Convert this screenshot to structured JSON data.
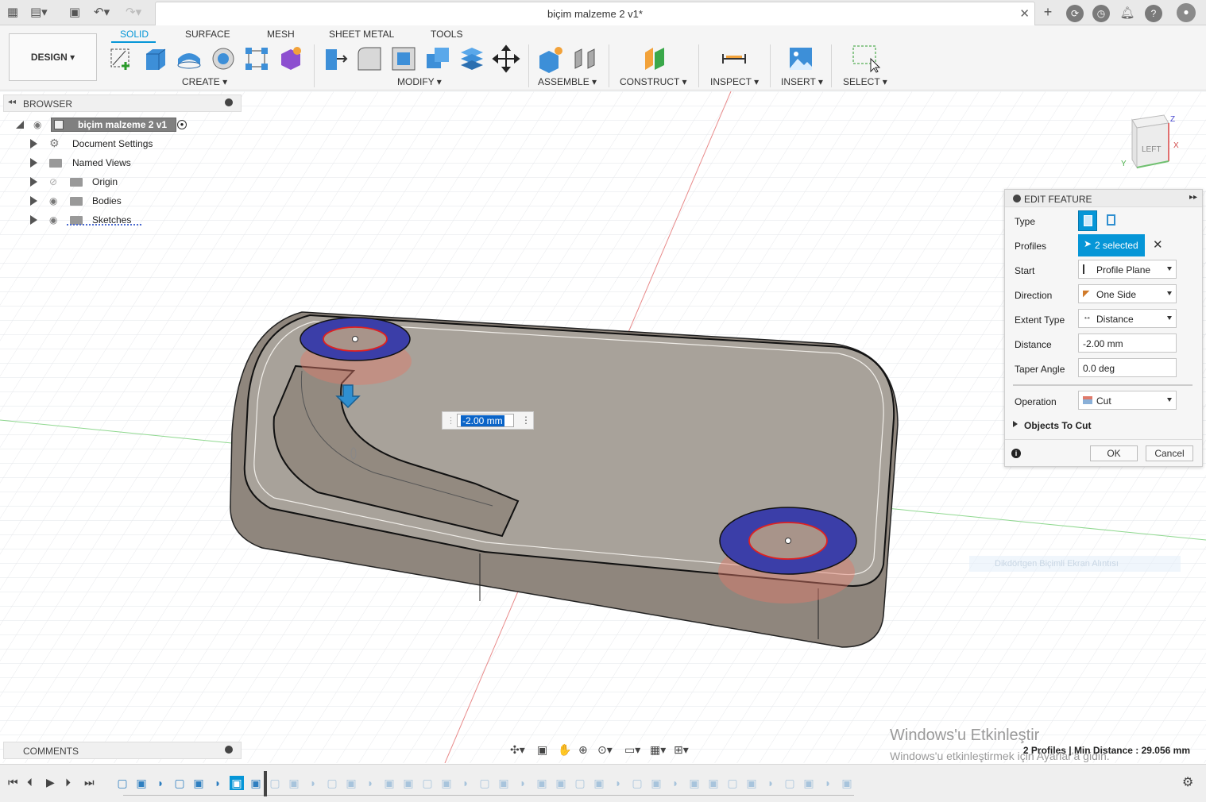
{
  "window": {
    "title": "biçim malzeme 2 v1*"
  },
  "workspace": {
    "design_label": "DESIGN",
    "tabs": [
      "SOLID",
      "SURFACE",
      "MESH",
      "SHEET METAL",
      "TOOLS"
    ],
    "groups": [
      "CREATE",
      "MODIFY",
      "ASSEMBLE",
      "CONSTRUCT",
      "INSPECT",
      "INSERT",
      "SELECT"
    ]
  },
  "browser": {
    "title": "BROWSER",
    "root": "biçim malzeme 2 v1",
    "items": [
      "Document Settings",
      "Named Views",
      "Origin",
      "Bodies",
      "Sketches"
    ]
  },
  "viewcube": {
    "face": "LEFT",
    "z": "Z",
    "x": "X",
    "y": "Y"
  },
  "dimension_input": {
    "value": "-2.00 mm"
  },
  "edit_feature": {
    "title": "EDIT FEATURE",
    "labels": {
      "type": "Type",
      "profiles": "Profiles",
      "start": "Start",
      "direction": "Direction",
      "extent_type": "Extent Type",
      "distance": "Distance",
      "taper_angle": "Taper Angle",
      "operation": "Operation"
    },
    "profiles_value": "2 selected",
    "start_value": "Profile Plane",
    "direction_value": "One Side",
    "extent_type_value": "Distance",
    "distance_value": "-2.00 mm",
    "taper_angle_value": "0.0 deg",
    "operation_value": "Cut",
    "objects_to_cut": "Objects To Cut",
    "ok": "OK",
    "cancel": "Cancel"
  },
  "comments": {
    "title": "COMMENTS"
  },
  "status": {
    "text": "2 Profiles | Min Distance : 29.056 mm"
  },
  "watermark": {
    "line1": "Windows'u Etkinleştir",
    "line2": "Windows'u etkinleştirmek için Ayarlar'a gidin."
  },
  "ghost_tooltip": "Dikdörtgen Biçimli Ekran Alıntısı",
  "colors": {
    "accent": "#0696d7",
    "body": "#a8a29a",
    "profile_fill": "#3b3ea8",
    "cut_preview": "#e07a6a"
  }
}
